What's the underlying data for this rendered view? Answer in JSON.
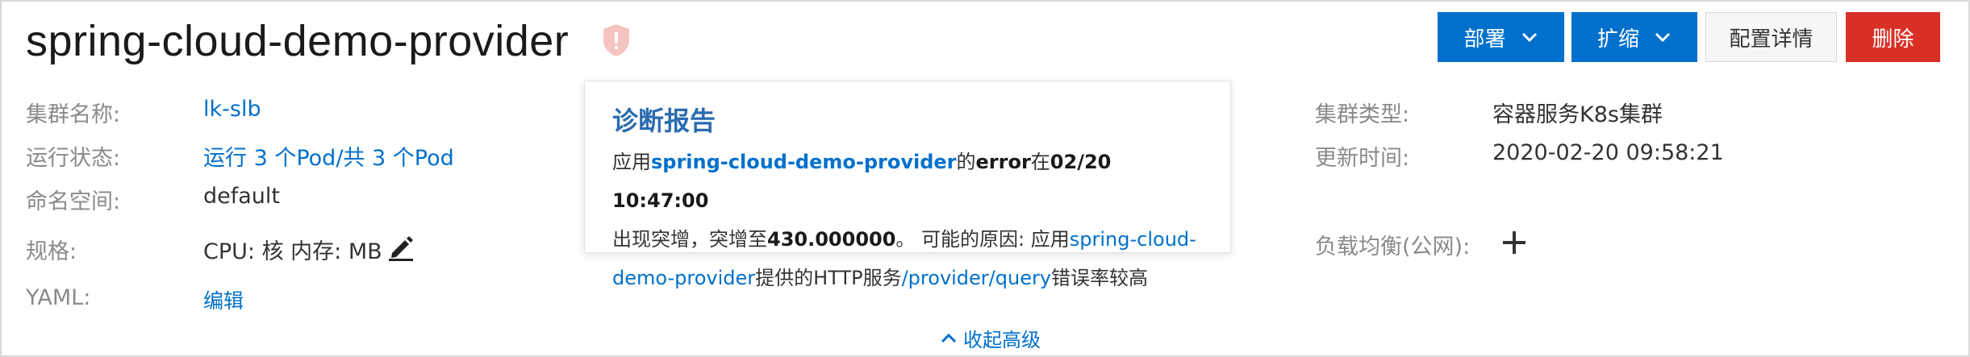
{
  "header": {
    "title": "spring-cloud-demo-provider",
    "buttons": {
      "deploy": "部署",
      "scale": "扩缩",
      "config_detail": "配置详情",
      "delete": "删除"
    }
  },
  "details": {
    "cluster_name": {
      "label": "集群名称:",
      "value": "lk-slb"
    },
    "run_status": {
      "label": "运行状态:",
      "value": "运行 3 个Pod/共 3 个Pod"
    },
    "namespace": {
      "label": "命名空间:",
      "value": "default"
    },
    "spec": {
      "label": "规格:",
      "value": "CPU: 核 内存: MB"
    },
    "yaml": {
      "label": "YAML:",
      "value": "编辑"
    },
    "cluster_type": {
      "label": "集群类型:",
      "value": "容器服务K8s集群"
    },
    "update_time": {
      "label": "更新时间:",
      "value": "2020-02-20 09:58:21"
    },
    "load_balancer": {
      "label": "负载均衡(公网):"
    }
  },
  "diagnosis": {
    "title": "诊断报告",
    "p1": "应用",
    "app": "spring-cloud-demo-provider",
    "p2": "的",
    "err": "error",
    "p3": "在",
    "time": "02/20 10:47:00",
    "p4": "出现突增，突增至",
    "value": "430.000000",
    "p5": "。 可能的原因: 应用",
    "app2": "spring-cloud-demo-provider",
    "p6": "提供的HTTP服务",
    "path": "/provider/query",
    "p7": "错误率较高"
  },
  "footer": {
    "collapse_label": "收起高级"
  },
  "colors": {
    "primary": "#0070cc",
    "danger": "#d93026",
    "label": "#8a8a8a",
    "diag_icon": "#f4b6b2"
  },
  "icons": [
    "shield-alert-icon",
    "chevron-down-icon",
    "edit-pencil-icon",
    "plus-icon",
    "chevron-up-icon"
  ]
}
